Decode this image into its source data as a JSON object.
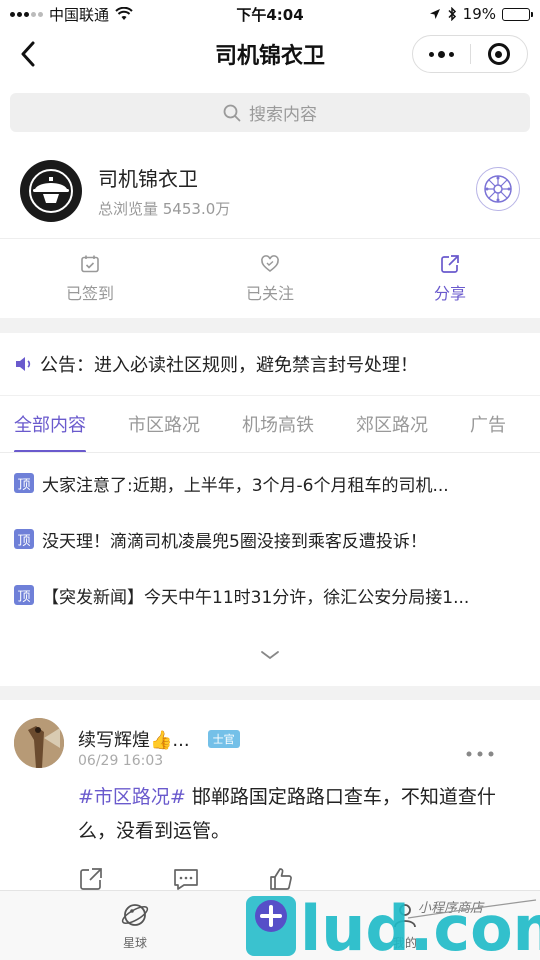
{
  "status_bar": {
    "carrier": "中国联通",
    "time": "下午4:04",
    "battery": "19%",
    "battery_level": 0.19
  },
  "navbar": {
    "title": "司机锦衣卫"
  },
  "search": {
    "placeholder": "搜索内容"
  },
  "profile": {
    "name": "司机锦衣卫",
    "views": "总浏览量 5453.0万"
  },
  "actions": [
    {
      "label": "已签到",
      "icon": "calendar-check-icon"
    },
    {
      "label": "已关注",
      "icon": "heart-icon"
    },
    {
      "label": "分享",
      "icon": "share-icon"
    }
  ],
  "notice": {
    "text": "公告：进入必读社区规则，避免禁言封号处理！"
  },
  "tabs": [
    {
      "label": "全部内容",
      "active": true
    },
    {
      "label": "市区路况",
      "active": false
    },
    {
      "label": "机场高铁",
      "active": false
    },
    {
      "label": "郊区路况",
      "active": false
    },
    {
      "label": "广告",
      "active": false
    }
  ],
  "pinned": {
    "tag": "顶",
    "items": [
      "大家注意了:近期，上半年，3个月-6个月租车的司机...",
      "没天理！滴滴司机凌晨兜5圈没接到乘客反遭投诉！",
      "【突发新闻】今天中午11时31分许，徐汇公安分局接1..."
    ]
  },
  "post": {
    "author": "续写辉煌👍...",
    "rank": "士官",
    "time": "06/29 16:03",
    "topic": "#市区路况#",
    "text": " 邯郸路国定路路口查车，不知道查什么，没看到运管。"
  },
  "tabbar": [
    {
      "label": "星球",
      "icon": "planet-icon"
    },
    {
      "label": "我的",
      "icon": "user-icon"
    }
  ],
  "watermark": {
    "text": "lud.com",
    "subtext": "小程序商店"
  },
  "colors": {
    "accent": "#6a5acd",
    "pin_tag": "#6f80d8",
    "rank_badge": "#74c0e8"
  }
}
